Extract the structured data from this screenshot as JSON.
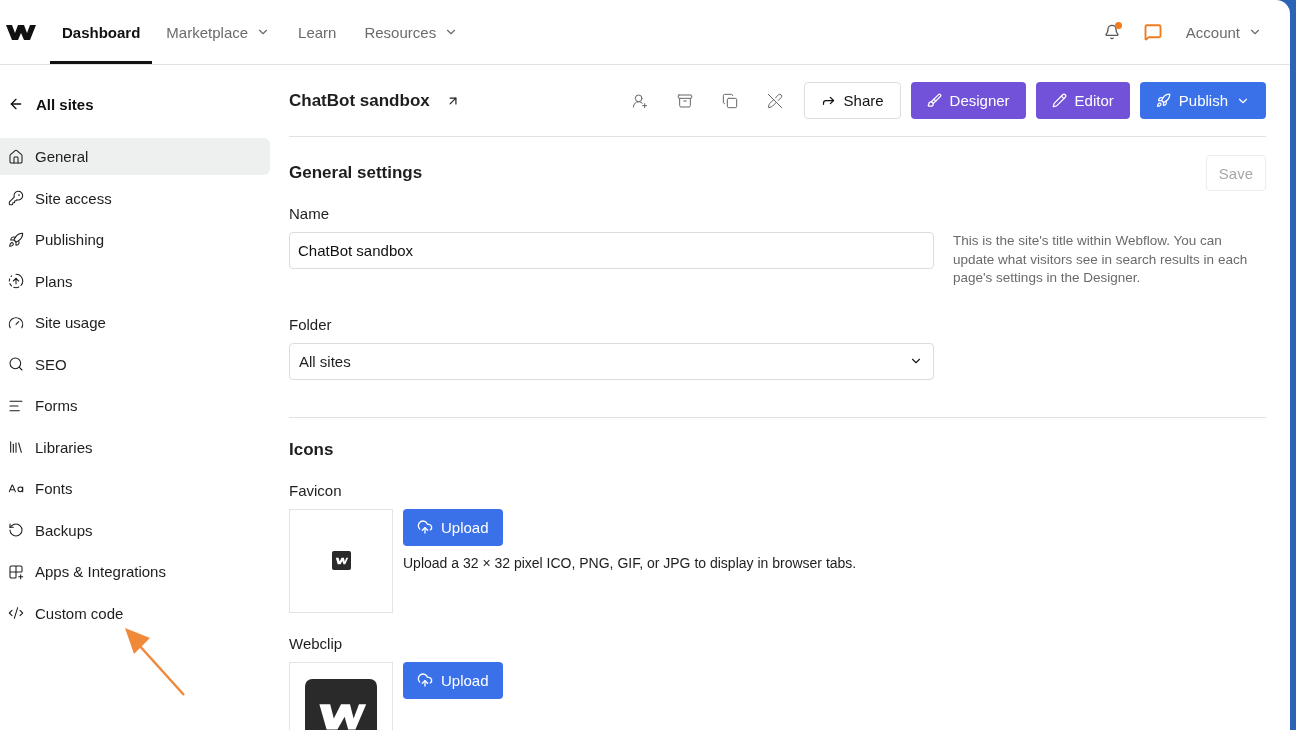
{
  "top_nav": {
    "items": [
      {
        "label": "Dashboard",
        "selected": true,
        "dropdown": false
      },
      {
        "label": "Marketplace",
        "selected": false,
        "dropdown": true
      },
      {
        "label": "Learn",
        "selected": false,
        "dropdown": false
      },
      {
        "label": "Resources",
        "selected": false,
        "dropdown": true
      }
    ],
    "notification_badge": true,
    "account": "Account"
  },
  "sidebar": {
    "back": "All sites",
    "items": [
      {
        "label": "General",
        "selected": true
      },
      {
        "label": "Site access",
        "selected": false
      },
      {
        "label": "Publishing",
        "selected": false
      },
      {
        "label": "Plans",
        "selected": false
      },
      {
        "label": "Site usage",
        "selected": false
      },
      {
        "label": "SEO",
        "selected": false
      },
      {
        "label": "Forms",
        "selected": false
      },
      {
        "label": "Libraries",
        "selected": false
      },
      {
        "label": "Fonts",
        "selected": false
      },
      {
        "label": "Backups",
        "selected": false
      },
      {
        "label": "Apps & Integrations",
        "selected": false
      },
      {
        "label": "Custom code",
        "selected": false
      }
    ]
  },
  "site_header": {
    "title": "ChatBot sandbox",
    "buttons": [
      {
        "label": "Share",
        "kind": "outline"
      },
      {
        "label": "Designer",
        "kind": "purple"
      },
      {
        "label": "Editor",
        "kind": "purple"
      },
      {
        "label": "Publish",
        "kind": "blue"
      }
    ]
  },
  "general_settings": {
    "title": "General settings",
    "save": {
      "label": "Save",
      "disabled": true
    },
    "name": {
      "label": "Name",
      "value": "ChatBot sandbox",
      "help": "This is the site's title within Webflow. You can update what visitors see in search results in each page's settings in the Designer."
    },
    "folder": {
      "label": "Folder",
      "value": "All sites"
    }
  },
  "icons_section": {
    "title": "Icons",
    "items": [
      {
        "label": "Favicon",
        "button": "Upload",
        "help": "Upload a 32 × 32 pixel ICO, PNG, GIF, or JPG to display in browser tabs."
      },
      {
        "label": "Webclip",
        "button": "Upload"
      }
    ]
  },
  "annotation": {
    "kind": "arrow"
  }
}
